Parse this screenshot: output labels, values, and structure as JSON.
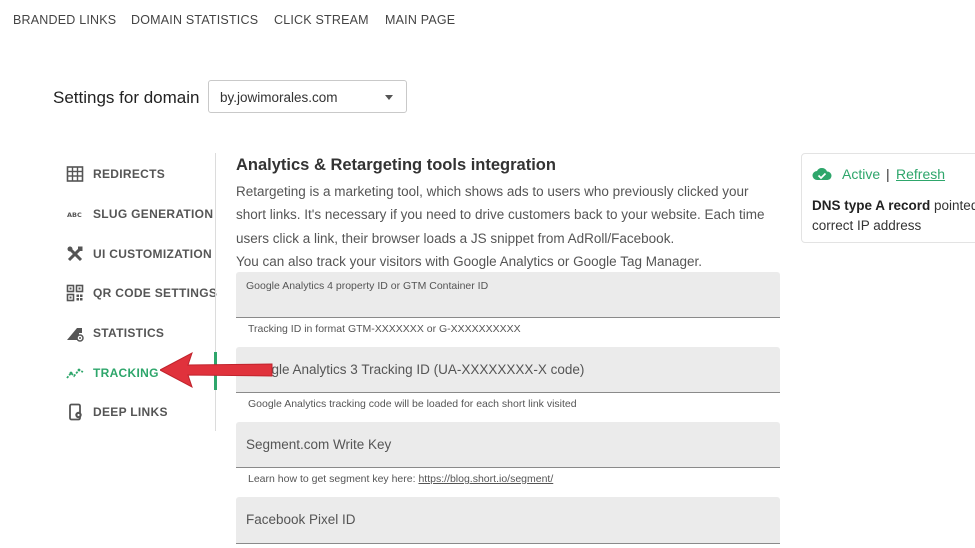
{
  "topnav": {
    "items": [
      "BRANDED LINKS",
      "DOMAIN STATISTICS",
      "CLICK STREAM",
      "MAIN PAGE"
    ]
  },
  "domain": {
    "title": "Settings for domain",
    "selected": "by.jowimorales.com"
  },
  "sidebar": {
    "items": [
      {
        "label": "REDIRECTS",
        "icon": "table-icon"
      },
      {
        "label": "SLUG GENERATION",
        "icon": "abc-icon"
      },
      {
        "label": "UI CUSTOMIZATION",
        "icon": "tools-icon"
      },
      {
        "label": "QR CODE SETTINGS",
        "icon": "qr-code-icon"
      },
      {
        "label": "STATISTICS",
        "icon": "statistics-icon"
      },
      {
        "label": "TRACKING",
        "icon": "tracking-icon",
        "active": true
      },
      {
        "label": "DEEP LINKS",
        "icon": "deep-link-icon"
      }
    ]
  },
  "main": {
    "title": "Analytics & Retargeting tools integration",
    "description": [
      "Retargeting is a marketing tool, which shows ads to users who previously clicked your",
      "short links. It's necessary if you need to drive customers back to your website. Each time",
      "users click a link, their browser loads a JS snippet from AdRoll/Facebook.",
      "You can also track your visitors with Google Analytics or Google Tag Manager."
    ],
    "fields": [
      {
        "placeholder": "Google Analytics 4 property ID or GTM Container ID",
        "helper": "Tracking ID in format GTM-XXXXXXX or G-XXXXXXXXXX"
      },
      {
        "placeholder": "Google Analytics 3 Tracking ID (UA-XXXXXXXX-X code)",
        "helper": "Google Analytics tracking code will be loaded for each short link visited"
      },
      {
        "placeholder": "Segment.com Write Key",
        "helper_prefix": "Learn how to get segment key here: ",
        "helper_link": "https://blog.short.io/segment/"
      },
      {
        "placeholder": "Facebook Pixel ID"
      }
    ]
  },
  "status": {
    "state": "Active",
    "separator": "|",
    "refresh": "Refresh",
    "dns_bold": "DNS type A record",
    "dns_rest": " pointed to",
    "dns_line2": "correct IP address"
  },
  "colors": {
    "accent": "#2ea66b",
    "arrow": "#e0323c"
  }
}
